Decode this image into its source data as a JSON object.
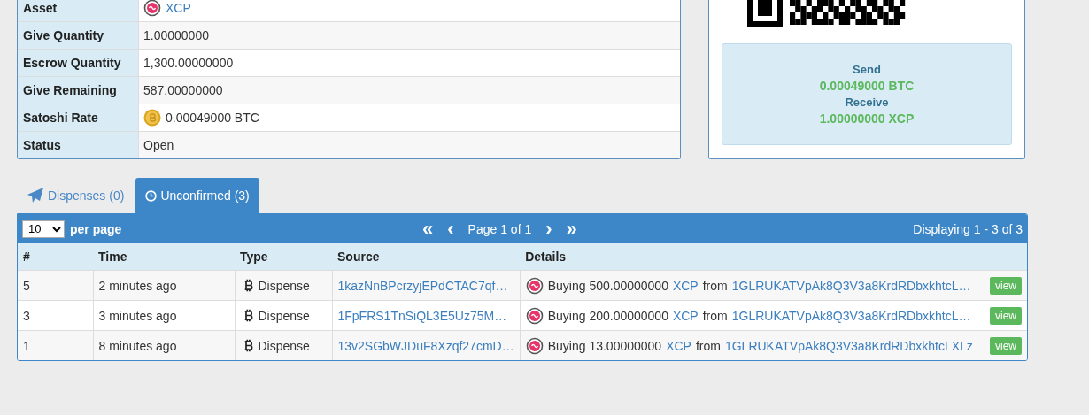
{
  "details_table": [
    {
      "label": "Asset",
      "value": "XCP",
      "kind": "asset"
    },
    {
      "label": "Give Quantity",
      "value": "1.00000000",
      "kind": "text"
    },
    {
      "label": "Escrow Quantity",
      "value": "1,300.00000000",
      "kind": "text"
    },
    {
      "label": "Give Remaining",
      "value": "587.00000000",
      "kind": "text"
    },
    {
      "label": "Satoshi Rate",
      "value": "0.00049000 BTC",
      "kind": "btc"
    },
    {
      "label": "Status",
      "value": "Open",
      "kind": "text"
    }
  ],
  "payment_box": {
    "send_label": "Send",
    "send_value": "0.00049000 BTC",
    "receive_label": "Receive",
    "receive_value": "1.00000000 XCP"
  },
  "tabs": [
    {
      "label": "Dispenses (0)",
      "selected": false
    },
    {
      "label": "Unconfirmed (3)",
      "selected": true
    }
  ],
  "pager": {
    "page_size": "10",
    "per_page": "per page",
    "first": "«",
    "prev": "‹",
    "page": "Page 1 of 1",
    "next": "›",
    "last": "»",
    "displaying": "Displaying 1 - 3 of 3"
  },
  "table": {
    "columns": [
      "#",
      "Time",
      "Type",
      "Source",
      "Details"
    ],
    "rows": [
      {
        "index": "5",
        "time": "2 minutes ago",
        "type": "Dispense",
        "source": "1kazNnBPcrzyjEPdCTAC7qf…",
        "buying": "Buying 500.00000000",
        "asset": "XCP",
        "from": "from",
        "address": "1GLRUKATVpAk8Q3V3a8KrdRDbxkhtcL…",
        "action": "view"
      },
      {
        "index": "3",
        "time": "3 minutes ago",
        "type": "Dispense",
        "source": "1FpFRS1TnSiQL3E5Uz75M…",
        "buying": "Buying 200.00000000",
        "asset": "XCP",
        "from": "from",
        "address": "1GLRUKATVpAk8Q3V3a8KrdRDbxkhtcL…",
        "action": "view"
      },
      {
        "index": "1",
        "time": "8 minutes ago",
        "type": "Dispense",
        "source": "13v2SGbWJDuF8Xzqf27cmD…",
        "buying": "Buying 13.00000000",
        "asset": "XCP",
        "from": "from",
        "address": "1GLRUKATVpAk8Q3V3a8KrdRDbxkhtcLXLz",
        "action": "view"
      }
    ]
  }
}
